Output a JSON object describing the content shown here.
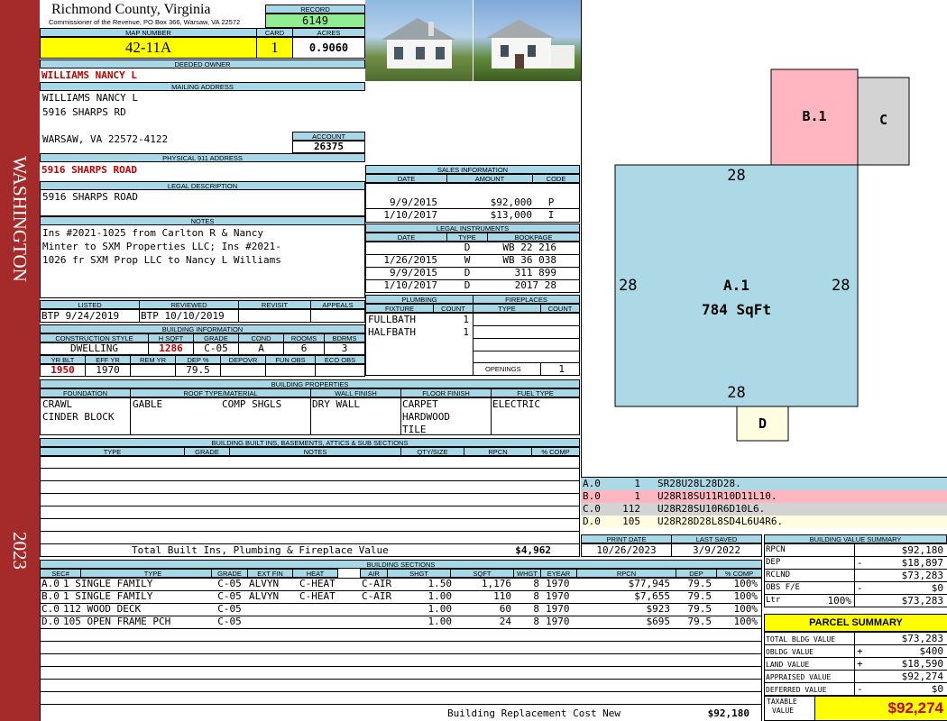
{
  "sidebar": {
    "district": "WASHINGTON",
    "year": "2023",
    "color": "#a52a2a"
  },
  "header": {
    "county": "Richmond County, Virginia",
    "commissioner": "Commissioner of the Revenue, PO Box 366, Warsaw, VA 22572",
    "record_label": "RECORD",
    "record": "6149",
    "map_label": "MAP NUMBER",
    "map_number": "42-11A",
    "card_label": "CARD",
    "card": "1",
    "acres_label": "ACRES",
    "acres": "0.9060"
  },
  "owner": {
    "deeded_label": "DEEDED OWNER",
    "deeded_owner": "WILLIAMS NANCY L",
    "mailing_label": "MAILING ADDRESS",
    "mailing_line1": "WILLIAMS NANCY L",
    "mailing_line2": "5916 SHARPS RD",
    "mailing_line3": "WARSAW, VA 22572-4122",
    "account_label": "ACCOUNT",
    "account": "26375",
    "physical_label": "PHYSICAL 911 ADDRESS",
    "physical_address": "5916 SHARPS ROAD",
    "legal_label": "LEGAL DESCRIPTION",
    "legal": "5916 SHARPS ROAD",
    "notes_label": "NOTES",
    "notes_line1": "Ins #2021-1025 from Carlton R & Nancy",
    "notes_line2": "Minter to SXM Properties LLC; Ins #2021-",
    "notes_line3": "1026 fr SXM Prop LLC to Nancy L Williams"
  },
  "review": {
    "listed_label": "LISTED",
    "listed": "BTP  9/24/2019",
    "reviewed_label": "REVIEWED",
    "reviewed": "BTP 10/10/2019",
    "revisit_label": "REVISIT",
    "appeals_label": "APPEALS"
  },
  "building_info": {
    "title": "BUILDING INFORMATION",
    "h": [
      "CONSTRUCTION STYLE",
      "H SQFT",
      "GRADE",
      "COND",
      "ROOMS",
      "BDRMS"
    ],
    "v": [
      "DWELLING",
      "1286",
      "C-05",
      "A",
      "6",
      "3"
    ],
    "h2": [
      "YR BLT",
      "EFF YR",
      "REM YR",
      "DEP %",
      "DEPOVR",
      "FUN OBS",
      "ECO OBS"
    ],
    "v2": [
      "1950",
      "1970",
      "",
      "79.5",
      "",
      "",
      ""
    ]
  },
  "sales": {
    "title": "SALES INFORMATION",
    "headers": [
      "DATE",
      "AMOUNT",
      "CODE"
    ],
    "rows": [
      [
        "9/9/2015",
        "$92,000",
        "P"
      ],
      [
        "1/10/2017",
        "$13,000",
        "I"
      ]
    ]
  },
  "legal_inst": {
    "title": "LEGAL INSTRUMENTS",
    "headers": [
      "DATE",
      "TYPE",
      "BOOKPAGE"
    ],
    "rows": [
      [
        "",
        "D",
        "WB 22 216"
      ],
      [
        "1/26/2015",
        "W",
        "WB 36 038"
      ],
      [
        "9/9/2015",
        "D",
        "311 899"
      ],
      [
        "1/10/2017",
        "D",
        "2017 28"
      ]
    ]
  },
  "plumbing": {
    "title": "PLUMBING",
    "headers": [
      "FIXTURE",
      "COUNT"
    ],
    "rows": [
      [
        "FULLBATH",
        "1"
      ],
      [
        "HALFBATH",
        "1"
      ]
    ]
  },
  "fireplaces": {
    "title": "FIREPLACES",
    "headers": [
      "TYPE",
      "COUNT"
    ],
    "openings_label": "OPENINGS",
    "openings": "1"
  },
  "props": {
    "title": "BUILDING PROPERTIES",
    "headers": [
      "FOUNDATION",
      "ROOF TYPE/MATERIAL",
      "WALL FINISH",
      "FLOOR FINISH",
      "FUEL TYPE"
    ],
    "foundation": [
      "CRAWL",
      "CINDER BLOCK"
    ],
    "roof_type": "GABLE",
    "roof_material": "COMP SHGLS",
    "wall": "DRY WALL",
    "floor": [
      "CARPET",
      "HARDWOOD",
      "TILE"
    ],
    "fuel": "ELECTRIC"
  },
  "builtins": {
    "title": "BUILDING BUILT INS, BASEMENTS, ATTICS & SUB SECTIONS",
    "headers": [
      "TYPE",
      "GRADE",
      "NOTES",
      "QTY/SIZE",
      "RPCN",
      "% COMP"
    ],
    "total_label": "Total Built Ins, Plumbing & Fireplace Value",
    "total_value": "$4,962"
  },
  "print": {
    "print_label": "PRINT DATE",
    "print_date": "10/26/2023",
    "saved_label": "LAST SAVED",
    "saved_date": "3/9/2022"
  },
  "sections": {
    "title": "BUILDING SECTIONS",
    "headers": [
      "SEC#",
      "TYPE",
      "GRADE",
      "EXT FIN",
      "HEAT",
      "AIR",
      "SHGT",
      "SQFT",
      "WHGT",
      "EYEAR",
      "RPCN",
      "DEP",
      "% COMP"
    ],
    "rows": [
      [
        "A.0",
        "1 SINGLE FAMILY",
        "C-05",
        "ALVYN",
        "C-HEAT",
        "C-AIR",
        "1.50",
        "1,176",
        "8",
        "1970",
        "$77,945",
        "79.5",
        "100%"
      ],
      [
        "B.0",
        "1 SINGLE FAMILY",
        "C-05",
        "ALVYN",
        "C-HEAT",
        "C-AIR",
        "1.00",
        "110",
        "8",
        "1970",
        "$7,655",
        "79.5",
        "100%"
      ],
      [
        "C.0",
        "112 WOOD DECK",
        "C-05",
        "",
        "",
        "",
        "1.00",
        "60",
        "8",
        "1970",
        "$923",
        "79.5",
        "100%"
      ],
      [
        "D.0",
        "105 OPEN FRAME PCH",
        "C-05",
        "",
        "",
        "",
        "1.00",
        "24",
        "8",
        "1970",
        "$695",
        "79.5",
        "100%"
      ]
    ],
    "replacement_label": "Building Replacement Cost New",
    "replacement_value": "$92,180"
  },
  "sketch": {
    "a_label": "A.1",
    "a_area": "784 SqFt",
    "top": "28",
    "left": "28",
    "right": "28",
    "bottom": "28",
    "b_label": "B.1",
    "c_label": "C",
    "d_label": "D",
    "colors": {
      "a": "#add8e6",
      "b": "#ffb6c1",
      "c": "#d3d3d3",
      "d": "#fffde0"
    }
  },
  "legend": {
    "rows": [
      {
        "code": "A.0",
        "num": "1",
        "path": "SR28U28L28D28.",
        "color": "#add8e6"
      },
      {
        "code": "B.0",
        "num": "1",
        "path": "U28R18SU11R10D11L10.",
        "color": "#ffb6c1"
      },
      {
        "code": "C.0",
        "num": "112",
        "path": "U28R28SU10R6D10L6.",
        "color": "#d3d3d3"
      },
      {
        "code": "D.0",
        "num": "105",
        "path": "U28R28D28L8SD4L6U4R6.",
        "color": "#fffde0"
      }
    ]
  },
  "value_summary": {
    "title": "BUILDING VALUE SUMMARY",
    "rpcn_label": "RPCN",
    "rpcn": "$92,180",
    "dep_label": "DEP",
    "dep_sign": "-",
    "dep": "$18,897",
    "rclnd_label": "RCLND",
    "rclnd": "$73,283",
    "obs_label": "OBS F/E",
    "obs_sign": "-",
    "obs": "$0",
    "ltr_label": "Ltr",
    "ltr_pct": "100%",
    "ltr": "$73,283"
  },
  "parcel": {
    "title": "PARCEL SUMMARY",
    "tbv_label": "TOTAL BLDG VALUE",
    "tbv": "$73,283",
    "obldg_label": "OBLDG VALUE",
    "obldg_sign": "+",
    "obldg": "$400",
    "land_label": "LAND VALUE",
    "land_sign": "+",
    "land": "$18,590",
    "appr_label": "APPRAISED VALUE",
    "appr": "$92,274",
    "def_label": "DEFERRED VALUE",
    "def_sign": "-",
    "def": "$0",
    "taxable_label1": "TAXABLE",
    "taxable_label2": "VALUE",
    "taxable": "$92,274"
  }
}
